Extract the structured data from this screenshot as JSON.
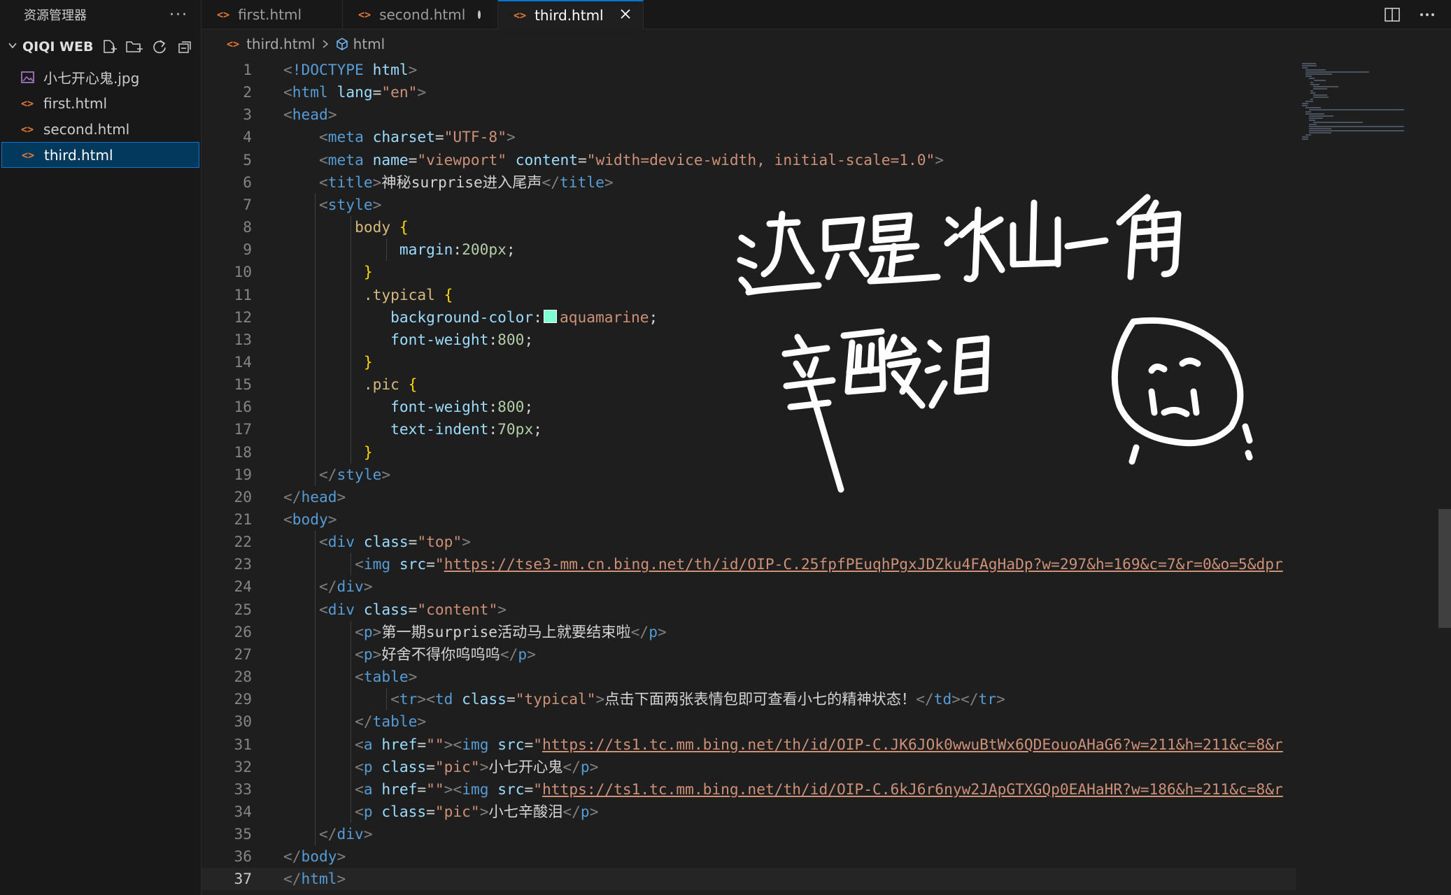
{
  "explorer": {
    "title": "资源管理器",
    "more": "···",
    "folder": "QIQI WEB",
    "files": [
      {
        "name": "小七开心鬼.jpg",
        "icon": "image-icon"
      },
      {
        "name": "first.html",
        "icon": "html-icon"
      },
      {
        "name": "second.html",
        "icon": "html-icon"
      },
      {
        "name": "third.html",
        "icon": "html-icon",
        "selected": true
      }
    ]
  },
  "tabs": [
    {
      "label": "first.html",
      "state": "inactive"
    },
    {
      "label": "second.html",
      "state": "modified"
    },
    {
      "label": "third.html",
      "state": "active"
    }
  ],
  "breadcrumb": {
    "file": "third.html",
    "symbol": "html"
  },
  "editor": {
    "current_line": 37,
    "lines": [
      [
        [
          "br",
          "<"
        ],
        [
          "tag",
          "!DOCTYPE"
        ],
        [
          "tx",
          " "
        ],
        [
          "at",
          "html"
        ],
        [
          "br",
          ">"
        ]
      ],
      [
        [
          "br",
          "<"
        ],
        [
          "tag",
          "html"
        ],
        [
          "tx",
          " "
        ],
        [
          "at",
          "lang"
        ],
        [
          "tx",
          "="
        ],
        [
          "st",
          "\"en\""
        ],
        [
          "br",
          ">"
        ]
      ],
      [
        [
          "br",
          "<"
        ],
        [
          "tag",
          "head"
        ],
        [
          "br",
          ">"
        ]
      ],
      [
        [
          "tx",
          "    "
        ],
        [
          "br",
          "<"
        ],
        [
          "tag",
          "meta"
        ],
        [
          "tx",
          " "
        ],
        [
          "at",
          "charset"
        ],
        [
          "tx",
          "="
        ],
        [
          "st",
          "\"UTF-8\""
        ],
        [
          "br",
          ">"
        ]
      ],
      [
        [
          "tx",
          "    "
        ],
        [
          "br",
          "<"
        ],
        [
          "tag",
          "meta"
        ],
        [
          "tx",
          " "
        ],
        [
          "at",
          "name"
        ],
        [
          "tx",
          "="
        ],
        [
          "st",
          "\"viewport\""
        ],
        [
          "tx",
          " "
        ],
        [
          "at",
          "content"
        ],
        [
          "tx",
          "="
        ],
        [
          "st",
          "\"width=device-width, initial-scale=1.0\""
        ],
        [
          "br",
          ">"
        ]
      ],
      [
        [
          "tx",
          "    "
        ],
        [
          "br",
          "<"
        ],
        [
          "tag",
          "title"
        ],
        [
          "br",
          ">"
        ],
        [
          "tx",
          "神秘surprise进入尾声"
        ],
        [
          "br",
          "</"
        ],
        [
          "tag",
          "title"
        ],
        [
          "br",
          ">"
        ]
      ],
      [
        [
          "tx",
          "    "
        ],
        [
          "br",
          "<"
        ],
        [
          "tag",
          "style"
        ],
        [
          "br",
          ">"
        ]
      ],
      [
        [
          "tx",
          "        "
        ],
        [
          "sel",
          "body"
        ],
        [
          "tx",
          " "
        ],
        [
          "bk",
          "{"
        ]
      ],
      [
        [
          "tx",
          "             "
        ],
        [
          "pr",
          "margin"
        ],
        [
          "tx",
          ":"
        ],
        [
          "nu",
          "200px"
        ],
        [
          "tx",
          ";"
        ]
      ],
      [
        [
          "tx",
          "         "
        ],
        [
          "bk",
          "}"
        ]
      ],
      [
        [
          "tx",
          "         "
        ],
        [
          "sel",
          ".typical"
        ],
        [
          "tx",
          " "
        ],
        [
          "bk",
          "{"
        ]
      ],
      [
        [
          "tx",
          "            "
        ],
        [
          "pr",
          "background-color"
        ],
        [
          "tx",
          ":"
        ],
        [
          "sw",
          "#7fffd4"
        ],
        [
          "st",
          "aquamarine"
        ],
        [
          "tx",
          ";"
        ]
      ],
      [
        [
          "tx",
          "            "
        ],
        [
          "pr",
          "font-weight"
        ],
        [
          "tx",
          ":"
        ],
        [
          "nu",
          "800"
        ],
        [
          "tx",
          ";"
        ]
      ],
      [
        [
          "tx",
          "         "
        ],
        [
          "bk",
          "}"
        ]
      ],
      [
        [
          "tx",
          "         "
        ],
        [
          "sel",
          ".pic"
        ],
        [
          "tx",
          " "
        ],
        [
          "bk",
          "{"
        ]
      ],
      [
        [
          "tx",
          "            "
        ],
        [
          "pr",
          "font-weight"
        ],
        [
          "tx",
          ":"
        ],
        [
          "nu",
          "800"
        ],
        [
          "tx",
          ";"
        ]
      ],
      [
        [
          "tx",
          "            "
        ],
        [
          "pr",
          "text-indent"
        ],
        [
          "tx",
          ":"
        ],
        [
          "nu",
          "70px"
        ],
        [
          "tx",
          ";"
        ]
      ],
      [
        [
          "tx",
          "         "
        ],
        [
          "bk",
          "}"
        ]
      ],
      [
        [
          "tx",
          "    "
        ],
        [
          "br",
          "</"
        ],
        [
          "tag",
          "style"
        ],
        [
          "br",
          ">"
        ]
      ],
      [
        [
          "br",
          "</"
        ],
        [
          "tag",
          "head"
        ],
        [
          "br",
          ">"
        ]
      ],
      [
        [
          "br",
          "<"
        ],
        [
          "tag",
          "body"
        ],
        [
          "br",
          ">"
        ]
      ],
      [
        [
          "tx",
          "    "
        ],
        [
          "br",
          "<"
        ],
        [
          "tag",
          "div"
        ],
        [
          "tx",
          " "
        ],
        [
          "at",
          "class"
        ],
        [
          "tx",
          "="
        ],
        [
          "st",
          "\"top\""
        ],
        [
          "br",
          ">"
        ]
      ],
      [
        [
          "tx",
          "        "
        ],
        [
          "br",
          "<"
        ],
        [
          "tag",
          "img"
        ],
        [
          "tx",
          " "
        ],
        [
          "at",
          "src"
        ],
        [
          "tx",
          "="
        ],
        [
          "st",
          "\""
        ],
        [
          "link",
          "https://tse3-mm.cn.bing.net/th/id/OIP-C.25fpfPEuqhPgxJDZku4FAgHaDp?w=297&h=169&c=7&r=0&o=5&dpr"
        ]
      ],
      [
        [
          "tx",
          "    "
        ],
        [
          "br",
          "</"
        ],
        [
          "tag",
          "div"
        ],
        [
          "br",
          ">"
        ]
      ],
      [
        [
          "tx",
          "    "
        ],
        [
          "br",
          "<"
        ],
        [
          "tag",
          "div"
        ],
        [
          "tx",
          " "
        ],
        [
          "at",
          "class"
        ],
        [
          "tx",
          "="
        ],
        [
          "st",
          "\"content\""
        ],
        [
          "br",
          ">"
        ]
      ],
      [
        [
          "tx",
          "        "
        ],
        [
          "br",
          "<"
        ],
        [
          "tag",
          "p"
        ],
        [
          "br",
          ">"
        ],
        [
          "tx",
          "第一期surprise活动马上就要结束啦"
        ],
        [
          "br",
          "</"
        ],
        [
          "tag",
          "p"
        ],
        [
          "br",
          ">"
        ]
      ],
      [
        [
          "tx",
          "        "
        ],
        [
          "br",
          "<"
        ],
        [
          "tag",
          "p"
        ],
        [
          "br",
          ">"
        ],
        [
          "tx",
          "好舍不得你呜呜呜"
        ],
        [
          "br",
          "</"
        ],
        [
          "tag",
          "p"
        ],
        [
          "br",
          ">"
        ]
      ],
      [
        [
          "tx",
          "        "
        ],
        [
          "br",
          "<"
        ],
        [
          "tag",
          "table"
        ],
        [
          "br",
          ">"
        ]
      ],
      [
        [
          "tx",
          "            "
        ],
        [
          "br",
          "<"
        ],
        [
          "tag",
          "tr"
        ],
        [
          "br",
          "><"
        ],
        [
          "tag",
          "td"
        ],
        [
          "tx",
          " "
        ],
        [
          "at",
          "class"
        ],
        [
          "tx",
          "="
        ],
        [
          "st",
          "\"typical\""
        ],
        [
          "br",
          ">"
        ],
        [
          "tx",
          "点击下面两张表情包即可查看小七的精神状态！"
        ],
        [
          "br",
          "</"
        ],
        [
          "tag",
          "td"
        ],
        [
          "br",
          "></"
        ],
        [
          "tag",
          "tr"
        ],
        [
          "br",
          ">"
        ]
      ],
      [
        [
          "tx",
          "        "
        ],
        [
          "br",
          "</"
        ],
        [
          "tag",
          "table"
        ],
        [
          "br",
          ">"
        ]
      ],
      [
        [
          "tx",
          "        "
        ],
        [
          "br",
          "<"
        ],
        [
          "tag",
          "a"
        ],
        [
          "tx",
          " "
        ],
        [
          "at",
          "href"
        ],
        [
          "tx",
          "="
        ],
        [
          "st",
          "\"\""
        ],
        [
          "br",
          "><"
        ],
        [
          "tag",
          "img"
        ],
        [
          "tx",
          " "
        ],
        [
          "at",
          "src"
        ],
        [
          "tx",
          "="
        ],
        [
          "st",
          "\""
        ],
        [
          "link",
          "https://ts1.tc.mm.bing.net/th/id/OIP-C.JK6JOk0wwuBtWx6QDEouoAHaG6?w=211&h=211&c=8&r"
        ]
      ],
      [
        [
          "tx",
          "        "
        ],
        [
          "br",
          "<"
        ],
        [
          "tag",
          "p"
        ],
        [
          "tx",
          " "
        ],
        [
          "at",
          "class"
        ],
        [
          "tx",
          "="
        ],
        [
          "st",
          "\"pic\""
        ],
        [
          "br",
          ">"
        ],
        [
          "tx",
          "小七开心鬼"
        ],
        [
          "br",
          "</"
        ],
        [
          "tag",
          "p"
        ],
        [
          "br",
          ">"
        ]
      ],
      [
        [
          "tx",
          "        "
        ],
        [
          "br",
          "<"
        ],
        [
          "tag",
          "a"
        ],
        [
          "tx",
          " "
        ],
        [
          "at",
          "href"
        ],
        [
          "tx",
          "="
        ],
        [
          "st",
          "\"\""
        ],
        [
          "br",
          "><"
        ],
        [
          "tag",
          "img"
        ],
        [
          "tx",
          " "
        ],
        [
          "at",
          "src"
        ],
        [
          "tx",
          "="
        ],
        [
          "st",
          "\""
        ],
        [
          "link",
          "https://ts1.tc.mm.bing.net/th/id/OIP-C.6kJ6r6nyw2JApGTXGQp0EAHaHR?w=186&h=211&c=8&r"
        ]
      ],
      [
        [
          "tx",
          "        "
        ],
        [
          "br",
          "<"
        ],
        [
          "tag",
          "p"
        ],
        [
          "tx",
          " "
        ],
        [
          "at",
          "class"
        ],
        [
          "tx",
          "="
        ],
        [
          "st",
          "\"pic\""
        ],
        [
          "br",
          ">"
        ],
        [
          "tx",
          "小七辛酸泪"
        ],
        [
          "br",
          "</"
        ],
        [
          "tag",
          "p"
        ],
        [
          "br",
          ">"
        ]
      ],
      [
        [
          "tx",
          "    "
        ],
        [
          "br",
          "</"
        ],
        [
          "tag",
          "div"
        ],
        [
          "br",
          ">"
        ]
      ],
      [
        [
          "br",
          "</"
        ],
        [
          "tag",
          "body"
        ],
        [
          "br",
          ">"
        ]
      ],
      [
        [
          "br",
          "</"
        ],
        [
          "tag",
          "html"
        ],
        [
          "br",
          ">"
        ]
      ]
    ]
  },
  "handwriting": {
    "line1": "这只是冰山一角",
    "line2": "辛酸泪"
  }
}
